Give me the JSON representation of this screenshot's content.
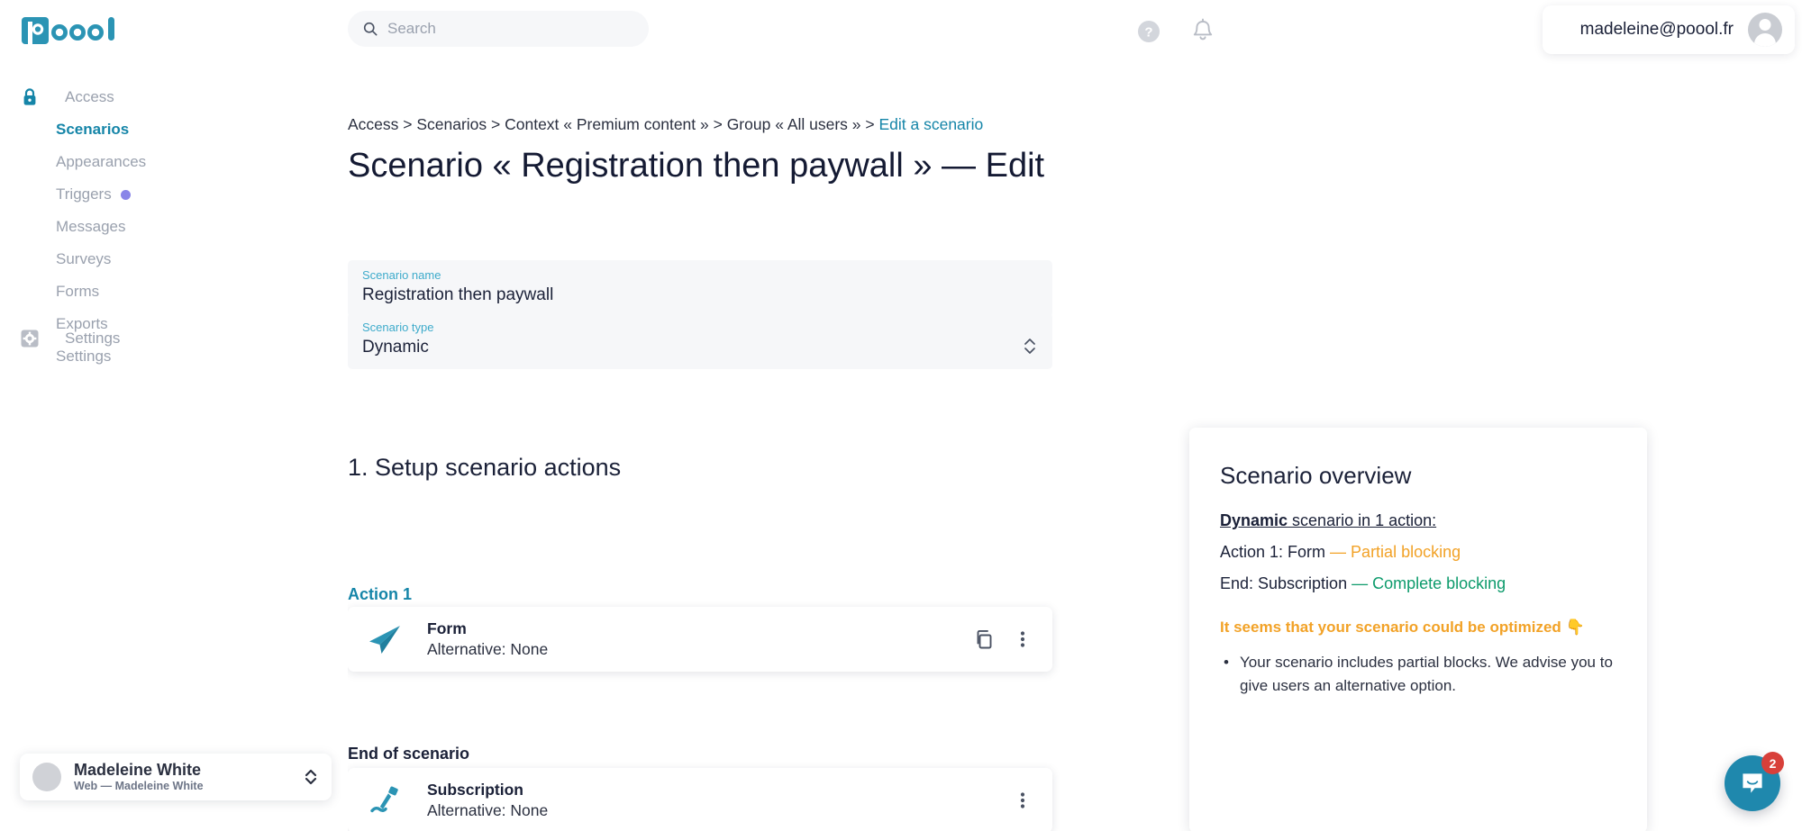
{
  "brand": {
    "logo_text": "poool",
    "accent": "#1585a8",
    "teal": "#2b94b4"
  },
  "topbar": {
    "search": {
      "placeholder": "Search",
      "value": "",
      "icon": "search-icon"
    },
    "help_icon": "help-circle-icon",
    "bell_icon": "bell-icon",
    "account_email": "madeleine@poool.fr",
    "avatar_icon": "user-avatar-icon"
  },
  "sidebar": {
    "group_label": "Access",
    "group_icon": "lock-icon",
    "items": [
      {
        "label": "Scenarios",
        "active": true,
        "dot": false
      },
      {
        "label": "Appearances",
        "active": false,
        "dot": false
      },
      {
        "label": "Triggers",
        "active": false,
        "dot": true
      },
      {
        "label": "Messages",
        "active": false,
        "dot": false
      },
      {
        "label": "Surveys",
        "active": false,
        "dot": false
      },
      {
        "label": "Forms",
        "active": false,
        "dot": false
      },
      {
        "label": "Exports",
        "active": false,
        "dot": false
      },
      {
        "label": "Settings",
        "active": false,
        "dot": false
      }
    ],
    "settings_group": {
      "label": "Settings",
      "icon": "gear-icon"
    },
    "workspace": {
      "name": "Madeleine White",
      "subtitle": "Web — Madeleine White",
      "caret_icon": "chevron-up-down-icon",
      "avatar_icon": "workspace-avatar-icon"
    }
  },
  "main": {
    "breadcrumb": {
      "parts": [
        "Access",
        "Scenarios",
        "Context « Premium content »",
        "Group « All users »"
      ],
      "separator": " > ",
      "current": "Edit a scenario"
    },
    "page_title": "Scenario « Registration then paywall » — Edit",
    "fields": {
      "name": {
        "label": "Scenario name",
        "value": "Registration then paywall"
      },
      "type": {
        "label": "Scenario type",
        "value": "Dynamic",
        "caret_icon": "chevron-up-down-icon"
      }
    },
    "section_title": "1. Setup scenario actions",
    "action_group_label": "Action 1",
    "action": {
      "name": "Form",
      "alternative": "Alternative: None",
      "icon": "paper-plane-icon",
      "copy_icon": "copy-icon",
      "menu_icon": "kebab-menu-icon"
    },
    "end_group_label": "End of scenario",
    "end_action": {
      "name": "Subscription",
      "alternative": "Alternative: None",
      "icon": "pen-icon",
      "menu_icon": "kebab-menu-icon"
    }
  },
  "overview": {
    "title": "Scenario overview",
    "summary_strong": "Dynamic",
    "summary_rest": " scenario in 1 action:",
    "action_line_prefix": "Action 1: Form ",
    "action_line_status": "— Partial blocking",
    "end_line_prefix": "End: Subscription ",
    "end_line_status": "— Complete blocking",
    "warning": "It seems that your scenario could be optimized 👇",
    "bullets": [
      "Your scenario includes partial blocks. We advise you to give users an alternative option."
    ],
    "colors": {
      "partial": "#f2a227",
      "complete": "#0d9b6c"
    }
  },
  "intercom": {
    "badge_count": "2",
    "icon": "chat-smile-icon"
  }
}
